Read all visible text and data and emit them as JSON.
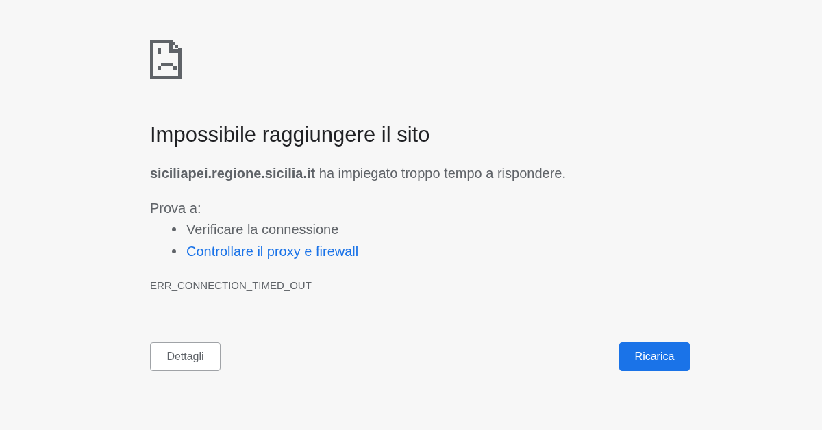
{
  "heading": "Impossibile raggiungere il sito",
  "message": "**siciliapei.regione.sicilia.it** ha impiegato troppo tempo a rispondere.",
  "suggestions": {
    "intro": "Prova a:",
    "items": [
      {
        "text": "Verificare la connessione",
        "kind": "text"
      },
      {
        "text": "Controllare il proxy e firewall",
        "kind": "link"
      }
    ]
  },
  "error_code": "ERR_CONNECTION_TIMED_OUT",
  "buttons": [
    {
      "label": "Dettagli",
      "kind": "secondary"
    },
    {
      "label": "Ricarica",
      "kind": "primary"
    }
  ]
}
